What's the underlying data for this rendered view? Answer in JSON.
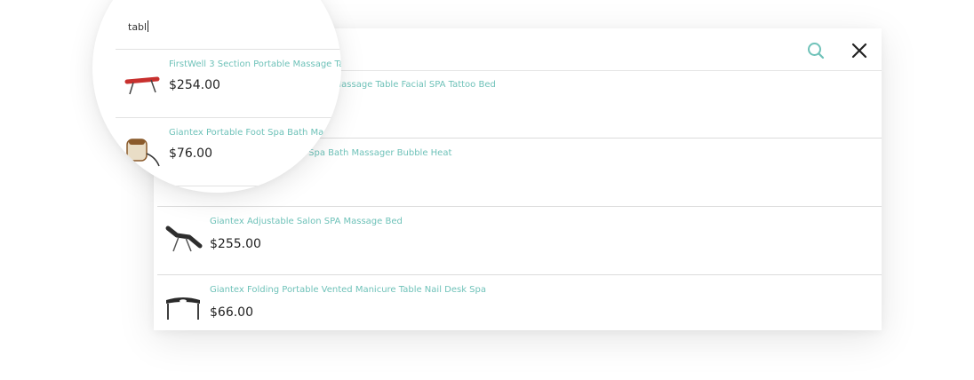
{
  "search": {
    "query": "tabl",
    "search_icon": "search-icon",
    "close_icon": "close-icon"
  },
  "colors": {
    "accent": "#6fc2b9",
    "price": "#222222",
    "divider": "#dcdcdc"
  },
  "results": [
    {
      "name": "FirstWell 3 Section Portable Massage Table Facial SPA Tattoo Bed",
      "price": "$254.00",
      "image": "massage-table-image"
    },
    {
      "name": "Giantex Portable Foot Spa Bath Massager Bubble Heat",
      "price": "$76.00",
      "image": "foot-spa-image"
    },
    {
      "name": "Giantex Adjustable Salon SPA Massage Bed",
      "price": "$255.00",
      "image": "salon-bed-image"
    },
    {
      "name": "Giantex Folding Portable Vented Manicure Table Nail Desk Spa",
      "price": "$66.00",
      "image": "manicure-table-image"
    }
  ]
}
